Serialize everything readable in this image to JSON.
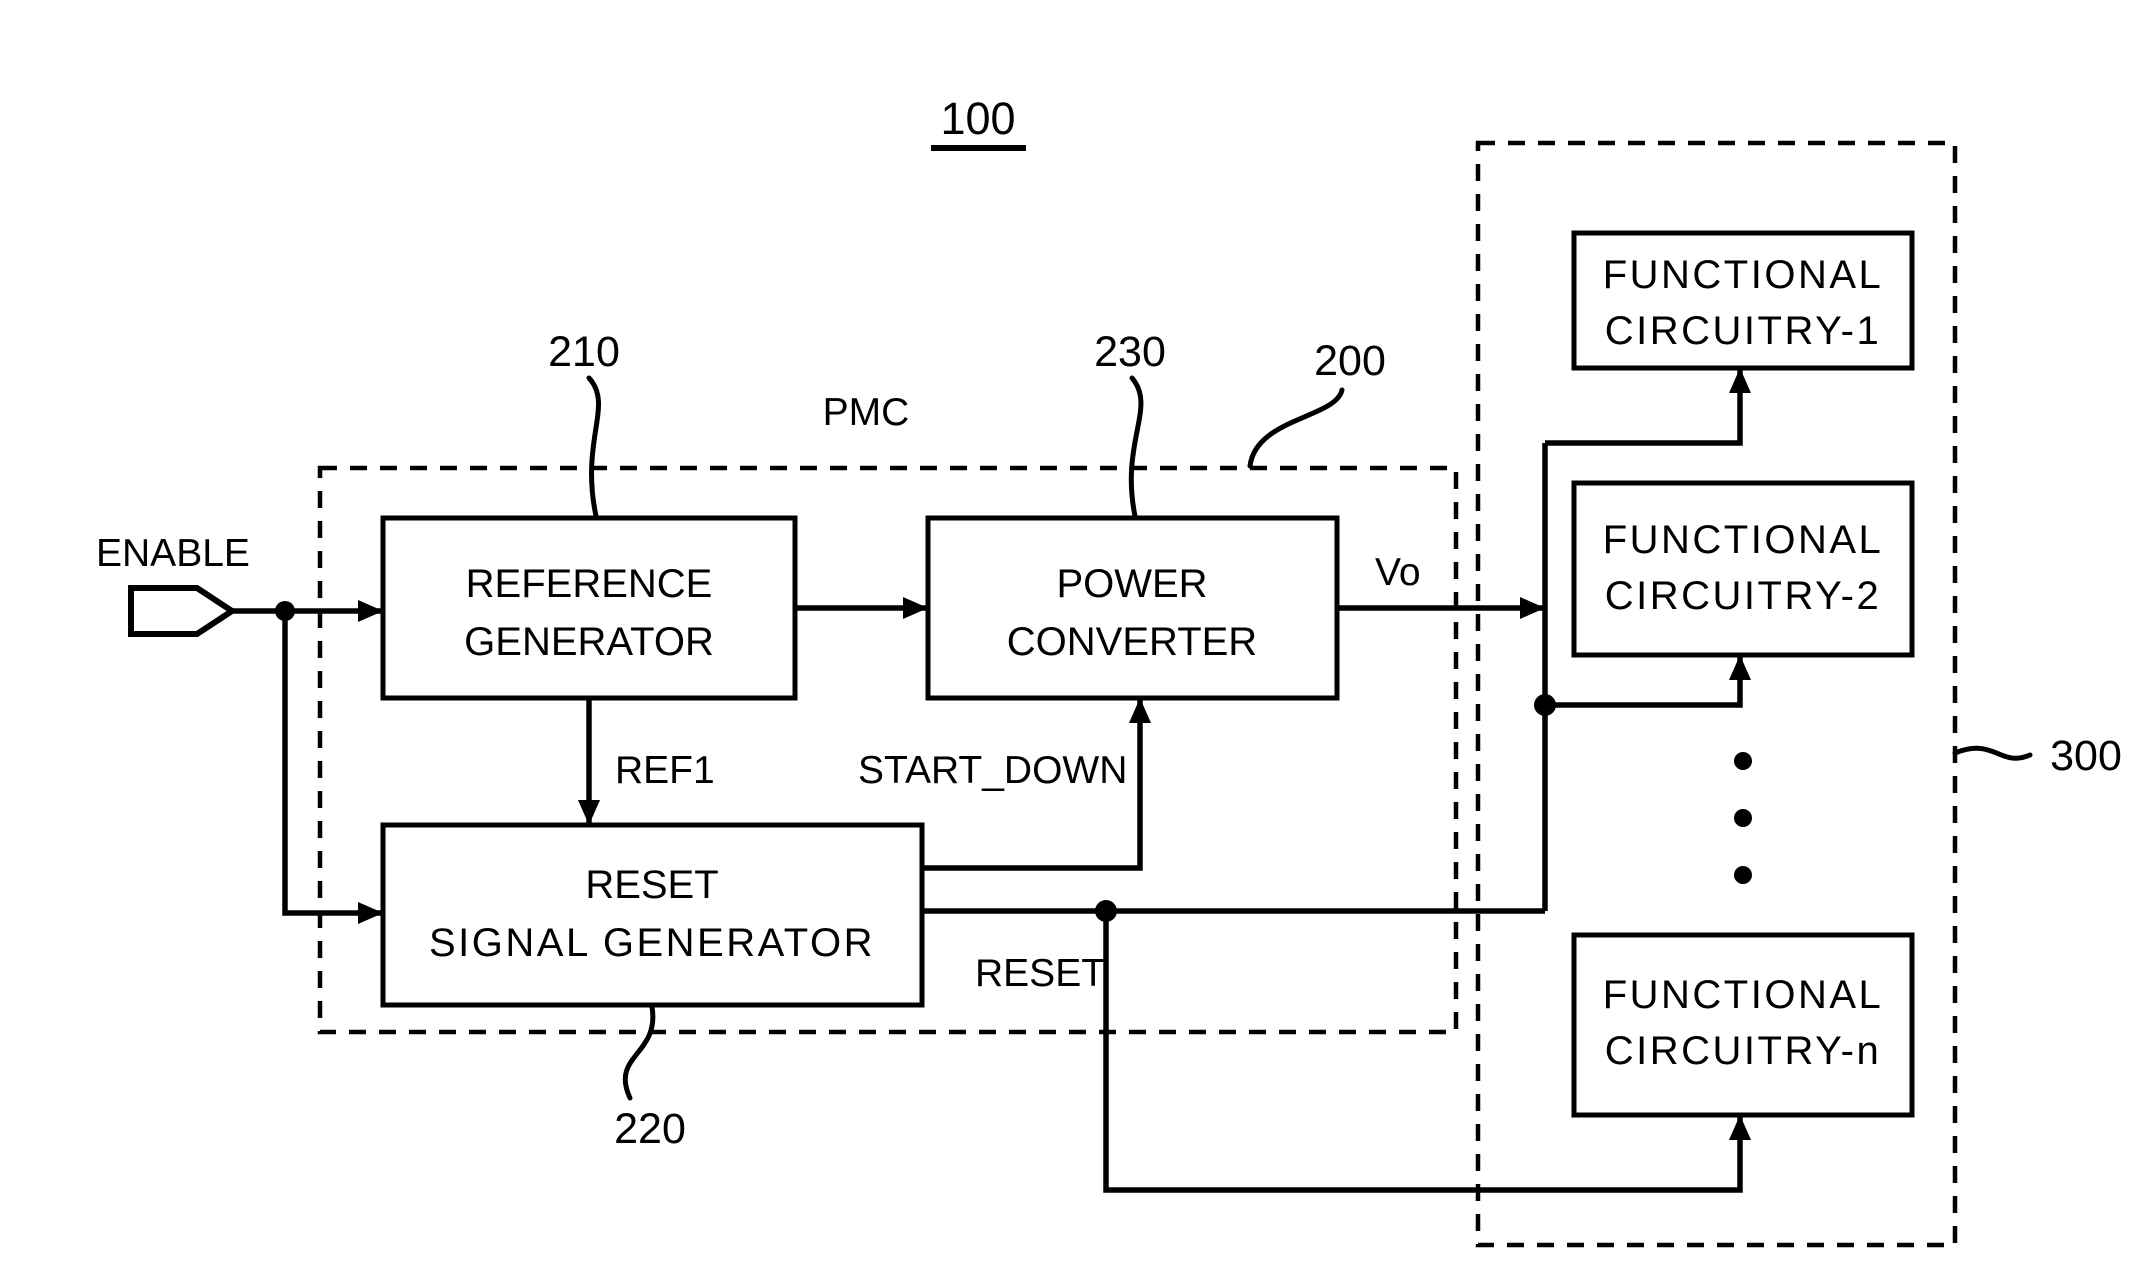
{
  "figure": {
    "title_number": "100",
    "pmc_label": "PMC"
  },
  "blocks": {
    "reference_generator": {
      "line1": "REFERENCE",
      "line2": "GENERATOR",
      "ref": "210"
    },
    "power_converter": {
      "line1": "POWER",
      "line2": "CONVERTER",
      "ref": "230"
    },
    "reset_signal_generator": {
      "line1": "RESET",
      "line2": "SIGNAL GENERATOR",
      "ref": "220"
    },
    "pmc_enclosure": {
      "ref": "200"
    },
    "functional_enclosure": {
      "ref": "300"
    },
    "functional_1": {
      "line1": "FUNCTIONAL",
      "line2": "CIRCUITRY-1"
    },
    "functional_2": {
      "line1": "FUNCTIONAL",
      "line2": "CIRCUITRY-2"
    },
    "functional_n": {
      "line1": "FUNCTIONAL",
      "line2": "CIRCUITRY-n"
    }
  },
  "signals": {
    "enable": "ENABLE",
    "ref1": "REF1",
    "start_down": "START_DOWN",
    "reset": "RESET",
    "vo": "Vo"
  },
  "colors": {
    "ink": "#000000",
    "paper": "#ffffff"
  }
}
